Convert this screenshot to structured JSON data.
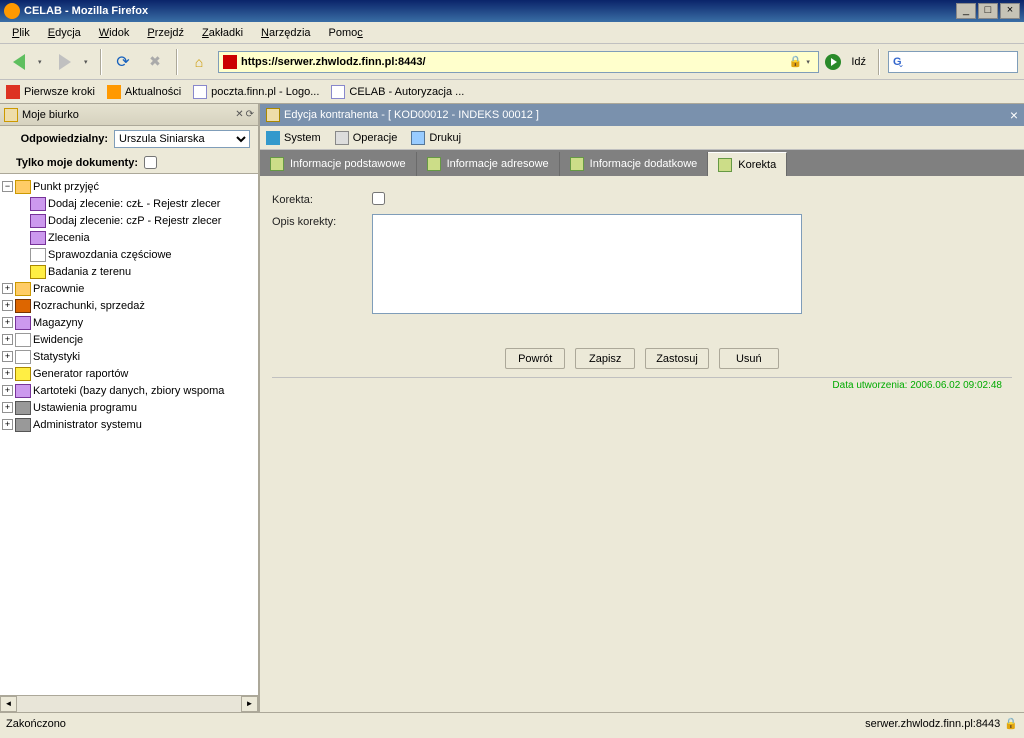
{
  "window": {
    "title": "CELAB - Mozilla Firefox"
  },
  "menu": {
    "file": "Plik",
    "edit": "Edycja",
    "view": "Widok",
    "go": "Przejdź",
    "bookmarks": "Zakładki",
    "tools": "Narzędzia",
    "help": "Pomoc"
  },
  "address": {
    "url": "https://serwer.zhwlodz.finn.pl:8443/",
    "go_label": "Idź"
  },
  "bookmarks": {
    "first": "Pierwsze kroki",
    "news": "Aktualności",
    "mail": "poczta.finn.pl - Logo...",
    "celab": "CELAB - Autoryzacja ..."
  },
  "left": {
    "title": "Moje biurko",
    "resp_label": "Odpowiedzialny:",
    "resp_value": "Urszula Siniarska",
    "only_mine": "Tylko moje dokumenty:",
    "tree": {
      "punkt": "Punkt przyjęć",
      "dodaj_czl": "Dodaj zlecenie: czŁ - Rejestr zlecer",
      "dodaj_czp": "Dodaj zlecenie: czP - Rejestr zlecer",
      "zlecenia": "Zlecenia",
      "sprawozdania": "Sprawozdania częściowe",
      "badania": "Badania z terenu",
      "pracownie": "Pracownie",
      "rozrachunki": "Rozrachunki, sprzedaż",
      "magazyny": "Magazyny",
      "ewidencje": "Ewidencje",
      "statystyki": "Statystyki",
      "generator": "Generator raportów",
      "kartoteki": "Kartoteki (bazy danych, zbiory wspoma",
      "ustawienia": "Ustawienia programu",
      "admin": "Administrator systemu"
    }
  },
  "right": {
    "title": "Edycja kontrahenta - [ KOD00012 - INDEKS 00012 ]",
    "tb": {
      "system": "System",
      "oper": "Operacje",
      "print": "Drukuj"
    },
    "tabs": {
      "t1": "Informacje podstawowe",
      "t2": "Informacje adresowe",
      "t3": "Informacje dodatkowe",
      "t4": "Korekta"
    },
    "form": {
      "korekta": "Korekta:",
      "opis": "Opis korekty:"
    },
    "btns": {
      "back": "Powrót",
      "save": "Zapisz",
      "apply": "Zastosuj",
      "delete": "Usuń"
    },
    "meta": "Data utworzenia: 2006.06.02 09:02:48"
  },
  "status": {
    "left": "Zakończono",
    "right": "serwer.zhwlodz.finn.pl:8443"
  }
}
